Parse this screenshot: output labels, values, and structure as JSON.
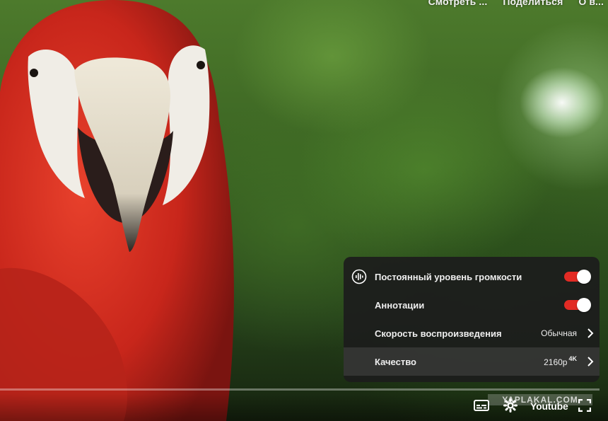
{
  "top_controls": {
    "watch_later": "Смотреть ...",
    "share": "Поделиться",
    "info": "О в..."
  },
  "settings_menu": {
    "items": [
      {
        "label": "Постоянный уровень громкости",
        "icon": "stable-volume-icon",
        "toggle": true
      },
      {
        "label": "Аннотации",
        "toggle": true
      },
      {
        "label": "Скорость воспроизведения",
        "value": "Обычная"
      },
      {
        "label": "Качество",
        "value": "2160p",
        "badge": "4K"
      }
    ]
  },
  "player": {
    "brand_logo": "Youtube",
    "watermark": "YAPLAKAL.COM"
  },
  "colors": {
    "toggle_on": "#e22b24",
    "menu_bg": "#1c1c1c"
  }
}
